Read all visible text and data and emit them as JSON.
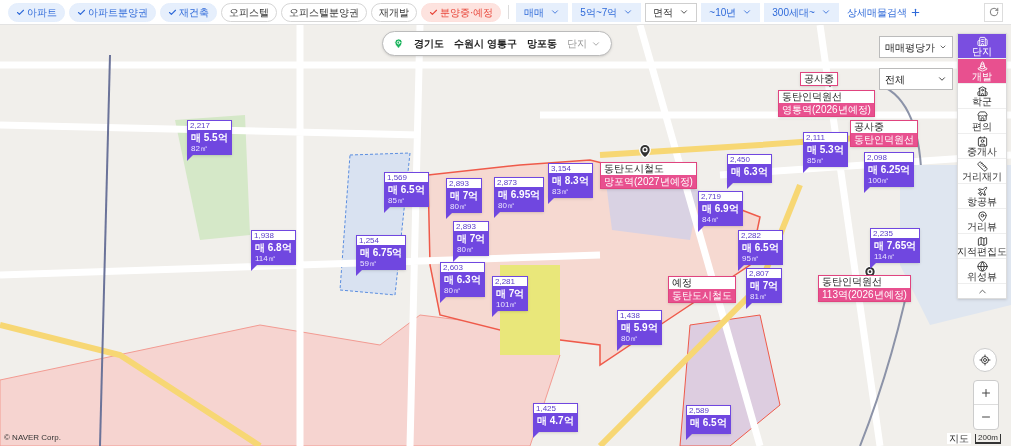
{
  "filters": {
    "chips": [
      {
        "label": "아파트",
        "checked": true,
        "kind": "type"
      },
      {
        "label": "아파트분양권",
        "checked": true,
        "kind": "type"
      },
      {
        "label": "재건축",
        "checked": true,
        "kind": "type"
      },
      {
        "label": "오피스텔",
        "checked": false,
        "kind": "type"
      },
      {
        "label": "오피스텔분양권",
        "checked": false,
        "kind": "type"
      },
      {
        "label": "재개발",
        "checked": false,
        "kind": "type"
      },
      {
        "label": "분양중·예정",
        "checked": true,
        "kind": "presale"
      }
    ],
    "dropdowns": [
      {
        "label": "매매",
        "set": true
      },
      {
        "label": "5억~7억",
        "set": true
      },
      {
        "label": "면적",
        "set": false
      },
      {
        "label": "~10년",
        "set": true
      },
      {
        "label": "300세대~",
        "set": true
      }
    ],
    "detail_search": "상세매물검색"
  },
  "location": {
    "segments": [
      "경기도",
      "수원시 영통구",
      "망포동"
    ],
    "level": "단지"
  },
  "right_panel": {
    "selects": [
      "매매평당가",
      "전체"
    ],
    "layers": [
      {
        "label": "단지",
        "on": true,
        "color": "#7a4ee0"
      },
      {
        "label": "개발",
        "on": true,
        "color": "#e8508f"
      },
      {
        "label": "학군",
        "on": false
      },
      {
        "label": "편의",
        "on": false
      },
      {
        "label": "중개사",
        "on": false
      },
      {
        "label": "거리재기",
        "on": false
      },
      {
        "label": "항공뷰",
        "on": false
      },
      {
        "label": "거리뷰",
        "on": false
      },
      {
        "label": "지적편집도",
        "on": false
      },
      {
        "label": "위성뷰",
        "on": false
      }
    ]
  },
  "complexes": [
    {
      "households": "2,217",
      "price": "매 5.5억",
      "area": "82㎡"
    },
    {
      "households": "1,569",
      "price": "매 6.5억",
      "area": "85㎡"
    },
    {
      "households": "1,938",
      "price": "매 6.8억",
      "area": "114㎡"
    },
    {
      "households": "1,254",
      "price": "매 6.75억",
      "area": "59㎡"
    },
    {
      "households": "2,893",
      "price": "매 7억",
      "area": "80㎡"
    },
    {
      "households": "2,873",
      "price": "매 6.95억",
      "area": "80㎡"
    },
    {
      "households": "3,154",
      "price": "매 8.3억",
      "area": "83㎡"
    },
    {
      "households": "2,893",
      "price": "매 7억",
      "area": "80㎡"
    },
    {
      "households": "2,603",
      "price": "매 6.3억",
      "area": "80㎡"
    },
    {
      "households": "2,281",
      "price": "매 7억",
      "area": "101㎡"
    },
    {
      "households": "2,450",
      "price": "매 6.3억"
    },
    {
      "households": "2,719",
      "price": "매 6.9억",
      "area": "84㎡"
    },
    {
      "households": "2,111",
      "price": "매 5.3억",
      "area": "85㎡"
    },
    {
      "households": "2,098",
      "price": "매 6.25억",
      "area": "100㎡"
    },
    {
      "households": "2,282",
      "price": "매 6.5억",
      "area": "95㎡"
    },
    {
      "households": "2,807",
      "price": "매 7억",
      "area": "81㎡"
    },
    {
      "households": "2,235",
      "price": "매 7.65억",
      "area": "114㎡"
    },
    {
      "households": "1,438",
      "price": "매 5.9억",
      "area": "80㎡"
    },
    {
      "households": "1,425",
      "price": "매 4.7억"
    },
    {
      "households": "2,589",
      "price": "매 6.5억"
    }
  ],
  "stations": [
    {
      "tag": "동탄도시철도",
      "name": "망포역(2027년예정)"
    },
    {
      "tag": "동탄인덕원선",
      "name": "영통역(2026년예정)"
    },
    {
      "tag": "공사중"
    },
    {
      "tag": "공사중",
      "name": "동탄인덕원선"
    },
    {
      "tag": "예정",
      "name": "동탄도시철도"
    },
    {
      "tag": "동탄인덕원선",
      "name": "113역(2026년예정)"
    }
  ],
  "copyright": "© NAVER Corp.",
  "scale": {
    "label": "지도",
    "distance": "200m"
  }
}
